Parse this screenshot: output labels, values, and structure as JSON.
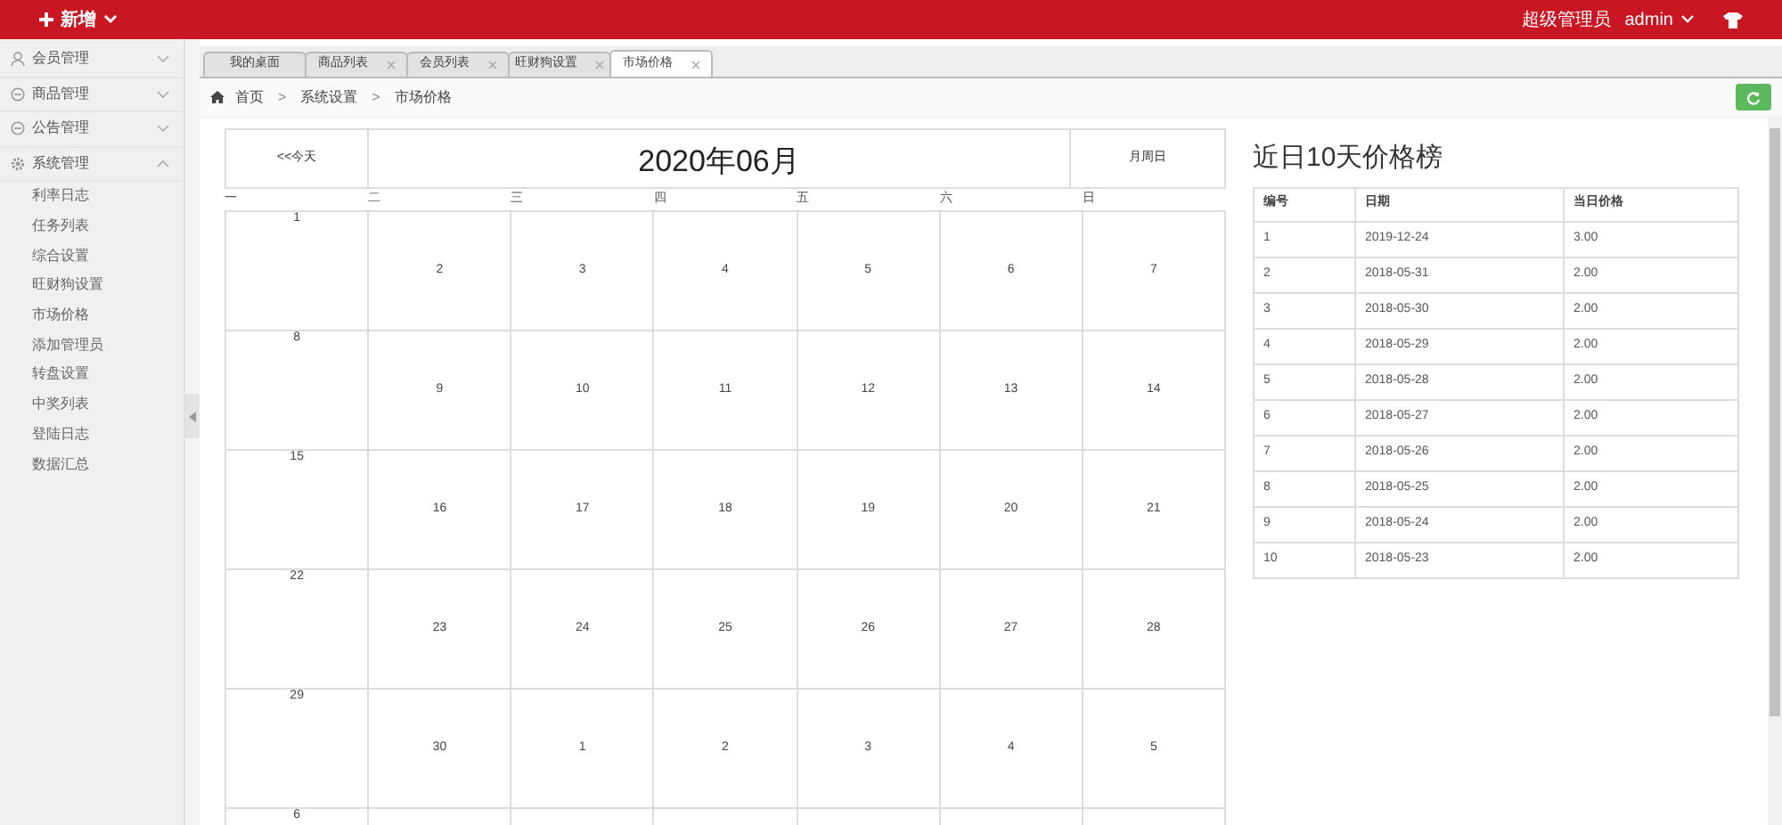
{
  "topbar": {
    "add_label": "新增",
    "user_role": "超级管理员",
    "user_name": "admin"
  },
  "sidebar": {
    "items": [
      {
        "label": "会员管理",
        "expanded": false
      },
      {
        "label": "商品管理",
        "expanded": false
      },
      {
        "label": "公告管理",
        "expanded": false
      },
      {
        "label": "系统管理",
        "expanded": true,
        "children": [
          {
            "label": "利率日志"
          },
          {
            "label": "任务列表"
          },
          {
            "label": "综合设置"
          },
          {
            "label": "旺财狗设置"
          },
          {
            "label": "市场价格"
          },
          {
            "label": "添加管理员"
          },
          {
            "label": "转盘设置"
          },
          {
            "label": "中奖列表"
          },
          {
            "label": "登陆日志"
          },
          {
            "label": "数据汇总"
          }
        ]
      }
    ]
  },
  "tabs": [
    {
      "label": "我的桌面",
      "closable": false,
      "selected": false
    },
    {
      "label": "商品列表",
      "closable": true,
      "selected": false
    },
    {
      "label": "会员列表",
      "closable": true,
      "selected": false
    },
    {
      "label": "旺财狗设置",
      "closable": true,
      "selected": false
    },
    {
      "label": "市场价格",
      "closable": true,
      "selected": true
    }
  ],
  "breadcrumb": [
    {
      "kind": "link",
      "text": "首页"
    },
    {
      "kind": "separator",
      "text": ">"
    },
    {
      "kind": "link",
      "text": "系统设置"
    },
    {
      "kind": "separator",
      "text": ">"
    },
    {
      "kind": "link",
      "text": "市场价格"
    }
  ],
  "calendar": {
    "prev_label": "<<今天",
    "title": "2020年06月",
    "next_label": "月周日",
    "weekdays": [
      "一",
      "二",
      "三",
      "四",
      "五",
      "六",
      "日"
    ],
    "weeks": [
      [
        "1",
        "2",
        "3",
        "4",
        "5",
        "6",
        "7"
      ],
      [
        "8",
        "9",
        "10",
        "11",
        "12",
        "13",
        "14"
      ],
      [
        "15",
        "16",
        "17",
        "18",
        "19",
        "20",
        "21"
      ],
      [
        "22",
        "23",
        "24",
        "25",
        "26",
        "27",
        "28"
      ],
      [
        "29",
        "30",
        "1",
        "2",
        "3",
        "4",
        "5"
      ],
      [
        "6"
      ]
    ]
  },
  "price_ranking": {
    "title": "近日10天价格榜",
    "columns": [
      "编号",
      "日期",
      "当日价格"
    ],
    "rows": [
      [
        "1",
        "2019-12-24",
        "3.00"
      ],
      [
        "2",
        "2018-05-31",
        "2.00"
      ],
      [
        "3",
        "2018-05-30",
        "2.00"
      ],
      [
        "4",
        "2018-05-29",
        "2.00"
      ],
      [
        "5",
        "2018-05-28",
        "2.00"
      ],
      [
        "6",
        "2018-05-27",
        "2.00"
      ],
      [
        "7",
        "2018-05-26",
        "2.00"
      ],
      [
        "8",
        "2018-05-25",
        "2.00"
      ],
      [
        "9",
        "2018-05-24",
        "2.00"
      ],
      [
        "10",
        "2018-05-23",
        "2.00"
      ]
    ]
  }
}
